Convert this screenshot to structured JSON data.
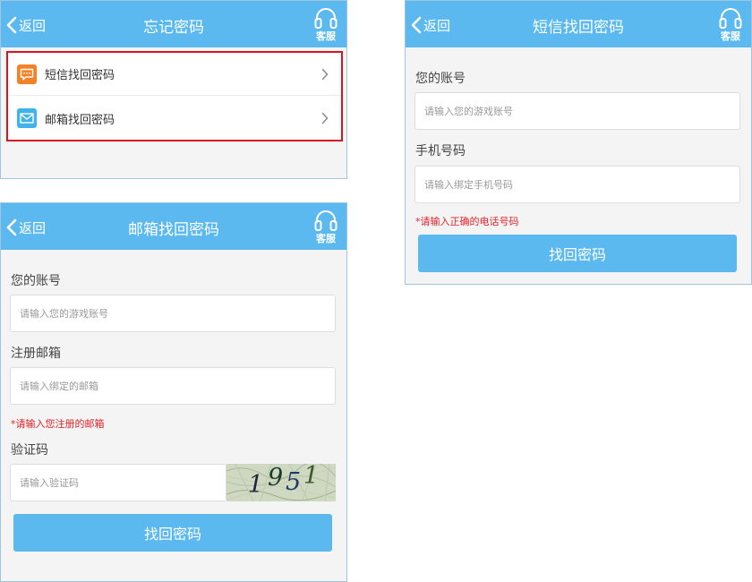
{
  "colors": {
    "header": "#5bb9f0",
    "button": "#5bb9f0",
    "error": "#e4222a",
    "highlight_border": "#d9141d",
    "sms_icon": "#f38227",
    "mail_icon": "#3fb3ea"
  },
  "header": {
    "back_label": "返回",
    "service_label": "客服"
  },
  "forgot": {
    "title": "忘记密码",
    "items": [
      {
        "label": "短信找回密码",
        "icon": "sms-icon"
      },
      {
        "label": "邮箱找回密码",
        "icon": "mail-icon"
      }
    ]
  },
  "email_page": {
    "title": "邮箱找回密码",
    "account_label": "您的账号",
    "account_placeholder": "请输入您的游戏账号",
    "email_label": "注册邮箱",
    "email_placeholder": "请输入绑定的邮箱",
    "email_error": "*请输入您注册的邮箱",
    "captcha_label": "验证码",
    "captcha_placeholder": "请输入验证码",
    "captcha_chars": [
      "1",
      "9",
      "5",
      "1"
    ],
    "submit": "找回密码"
  },
  "sms_page": {
    "title": "短信找回密码",
    "account_label": "您的账号",
    "account_placeholder": "请输入您的游戏账号",
    "phone_label": "手机号码",
    "phone_placeholder": "请输入绑定手机号码",
    "phone_error": "*请输入正确的电话号码",
    "submit": "找回密码"
  }
}
